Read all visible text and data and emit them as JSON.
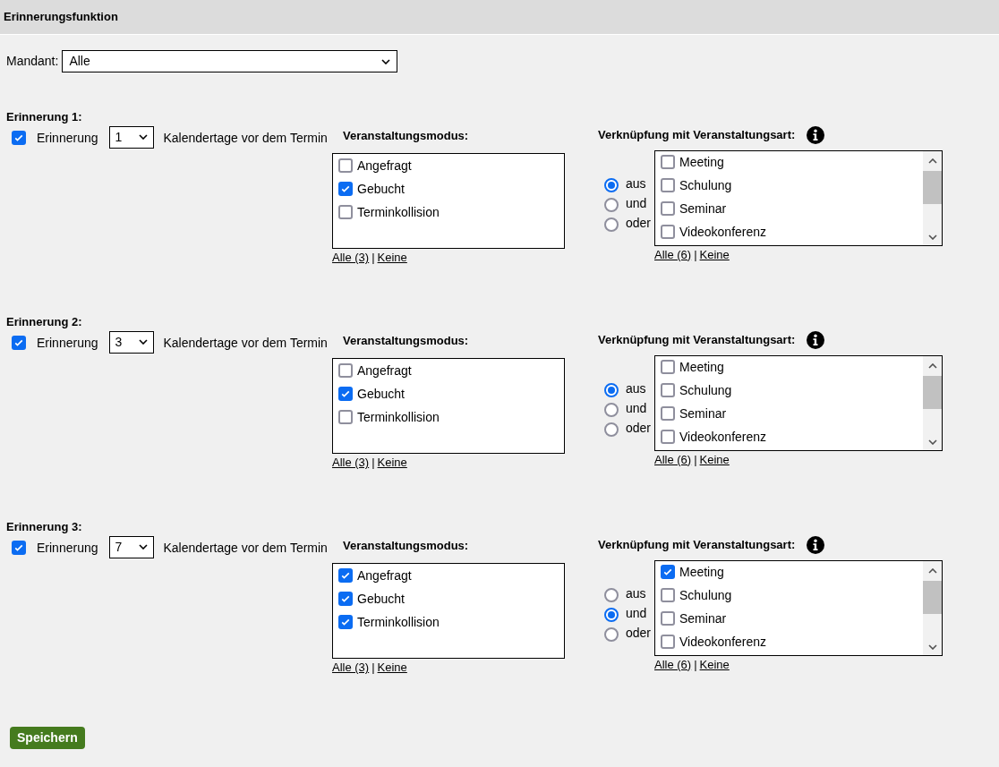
{
  "header": {
    "title": "Erinnerungsfunktion"
  },
  "mandant": {
    "label": "Mandant:",
    "value": "Alle"
  },
  "reminders": [
    {
      "title": "Erinnerung 1:",
      "enabled": true,
      "label": "Erinnerung",
      "days": "1",
      "suffix": "Kalendertage vor dem Termin",
      "mode": {
        "title": "Veranstaltungsmodus:",
        "options": [
          {
            "label": "Angefragt",
            "checked": false
          },
          {
            "label": "Gebucht",
            "checked": true
          },
          {
            "label": "Terminkollision",
            "checked": false
          }
        ],
        "all_link": "Alle (3)",
        "none_link": "Keine"
      },
      "link": {
        "title": "Verknüpfung mit Veranstaltungsart:",
        "operators": [
          {
            "label": "aus",
            "selected": true
          },
          {
            "label": "und",
            "selected": false
          },
          {
            "label": "oder",
            "selected": false
          }
        ],
        "types": [
          {
            "label": "Meeting",
            "checked": false
          },
          {
            "label": "Schulung",
            "checked": false
          },
          {
            "label": "Seminar",
            "checked": false
          },
          {
            "label": "Videokonferenz",
            "checked": false
          }
        ],
        "all_link": "Alle (6)",
        "none_link": "Keine"
      }
    },
    {
      "title": "Erinnerung 2:",
      "enabled": true,
      "label": "Erinnerung",
      "days": "3",
      "suffix": "Kalendertage vor dem Termin",
      "mode": {
        "title": "Veranstaltungsmodus:",
        "options": [
          {
            "label": "Angefragt",
            "checked": false
          },
          {
            "label": "Gebucht",
            "checked": true
          },
          {
            "label": "Terminkollision",
            "checked": false
          }
        ],
        "all_link": "Alle (3)",
        "none_link": "Keine"
      },
      "link": {
        "title": "Verknüpfung mit Veranstaltungsart:",
        "operators": [
          {
            "label": "aus",
            "selected": true
          },
          {
            "label": "und",
            "selected": false
          },
          {
            "label": "oder",
            "selected": false
          }
        ],
        "types": [
          {
            "label": "Meeting",
            "checked": false
          },
          {
            "label": "Schulung",
            "checked": false
          },
          {
            "label": "Seminar",
            "checked": false
          },
          {
            "label": "Videokonferenz",
            "checked": false
          }
        ],
        "all_link": "Alle (6)",
        "none_link": "Keine"
      }
    },
    {
      "title": "Erinnerung 3:",
      "enabled": true,
      "label": "Erinnerung",
      "days": "7",
      "suffix": "Kalendertage vor dem Termin",
      "mode": {
        "title": "Veranstaltungsmodus:",
        "options": [
          {
            "label": "Angefragt",
            "checked": true
          },
          {
            "label": "Gebucht",
            "checked": true
          },
          {
            "label": "Terminkollision",
            "checked": true
          }
        ],
        "all_link": "Alle (3)",
        "none_link": "Keine"
      },
      "link": {
        "title": "Verknüpfung mit Veranstaltungsart:",
        "operators": [
          {
            "label": "aus",
            "selected": false
          },
          {
            "label": "und",
            "selected": true
          },
          {
            "label": "oder",
            "selected": false
          }
        ],
        "types": [
          {
            "label": "Meeting",
            "checked": true
          },
          {
            "label": "Schulung",
            "checked": false
          },
          {
            "label": "Seminar",
            "checked": false
          },
          {
            "label": "Videokonferenz",
            "checked": false
          }
        ],
        "all_link": "Alle (6)",
        "none_link": "Keine"
      }
    }
  ],
  "separator": "|",
  "save_button": "Speichern"
}
